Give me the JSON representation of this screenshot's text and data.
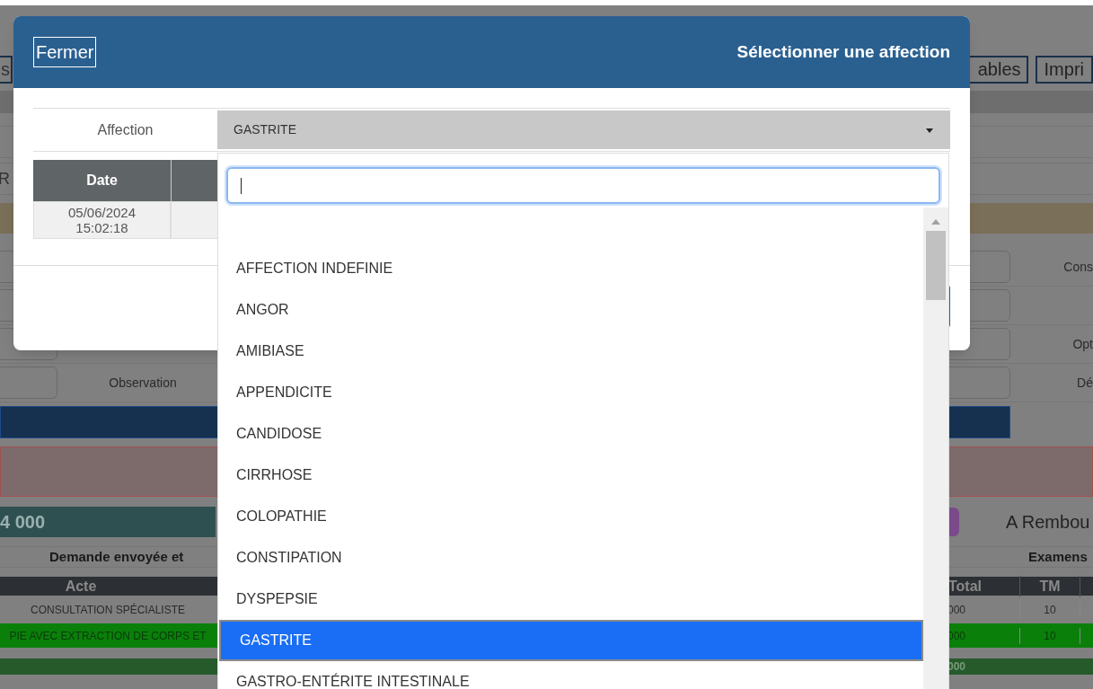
{
  "background_page": {
    "left_tabs": [
      "s"
    ],
    "right_buttons": [
      "ables",
      "Impri"
    ],
    "row_label": "R",
    "form_rows": [
      {
        "kind": "field",
        "right": "Cons"
      },
      {
        "kind": "field"
      },
      {
        "kind": "field",
        "right": "Opt"
      },
      {
        "kind": "field",
        "left": "Observation",
        "right": "Dé"
      }
    ],
    "amount": "4 000",
    "refund_label": "A Rembou",
    "section_left": "Demande envoyée et",
    "section_right": "Examens",
    "table": {
      "columns": [
        "Acte",
        "Total",
        "TM"
      ],
      "rows": [
        {
          "kind": "normal",
          "acte": "CONSULTATION SPÉCIALISTE",
          "total": "000",
          "tm": "10"
        },
        {
          "kind": "highlight",
          "acte": "PIE AVEC EXTRACTION DE CORPS ET",
          "total": "000",
          "tm": "10"
        },
        {
          "kind": "total",
          "total": "000"
        }
      ]
    }
  },
  "modal": {
    "close_button": "Fermer",
    "title": "Sélectionner une affection",
    "field_label": "Affection",
    "select_value": "GASTRITE",
    "history": {
      "columns": [
        "Date"
      ],
      "rows": [
        {
          "date": "05/06/2024",
          "time": "15:02:18"
        }
      ]
    }
  },
  "dropdown": {
    "items": [
      {
        "label": "AFFECTION INDEFINIE",
        "selected": false
      },
      {
        "label": "ANGOR",
        "selected": false
      },
      {
        "label": "AMIBIASE",
        "selected": false
      },
      {
        "label": "APPENDICITE",
        "selected": false
      },
      {
        "label": "CANDIDOSE",
        "selected": false
      },
      {
        "label": "CIRRHOSE",
        "selected": false
      },
      {
        "label": "COLOPATHIE",
        "selected": false
      },
      {
        "label": "CONSTIPATION",
        "selected": false
      },
      {
        "label": "DYSPEPSIE",
        "selected": false
      },
      {
        "label": "GASTRITE",
        "selected": true
      },
      {
        "label": "GASTRO-ENTÉRITE INTESTINALE",
        "selected": false
      }
    ]
  }
}
